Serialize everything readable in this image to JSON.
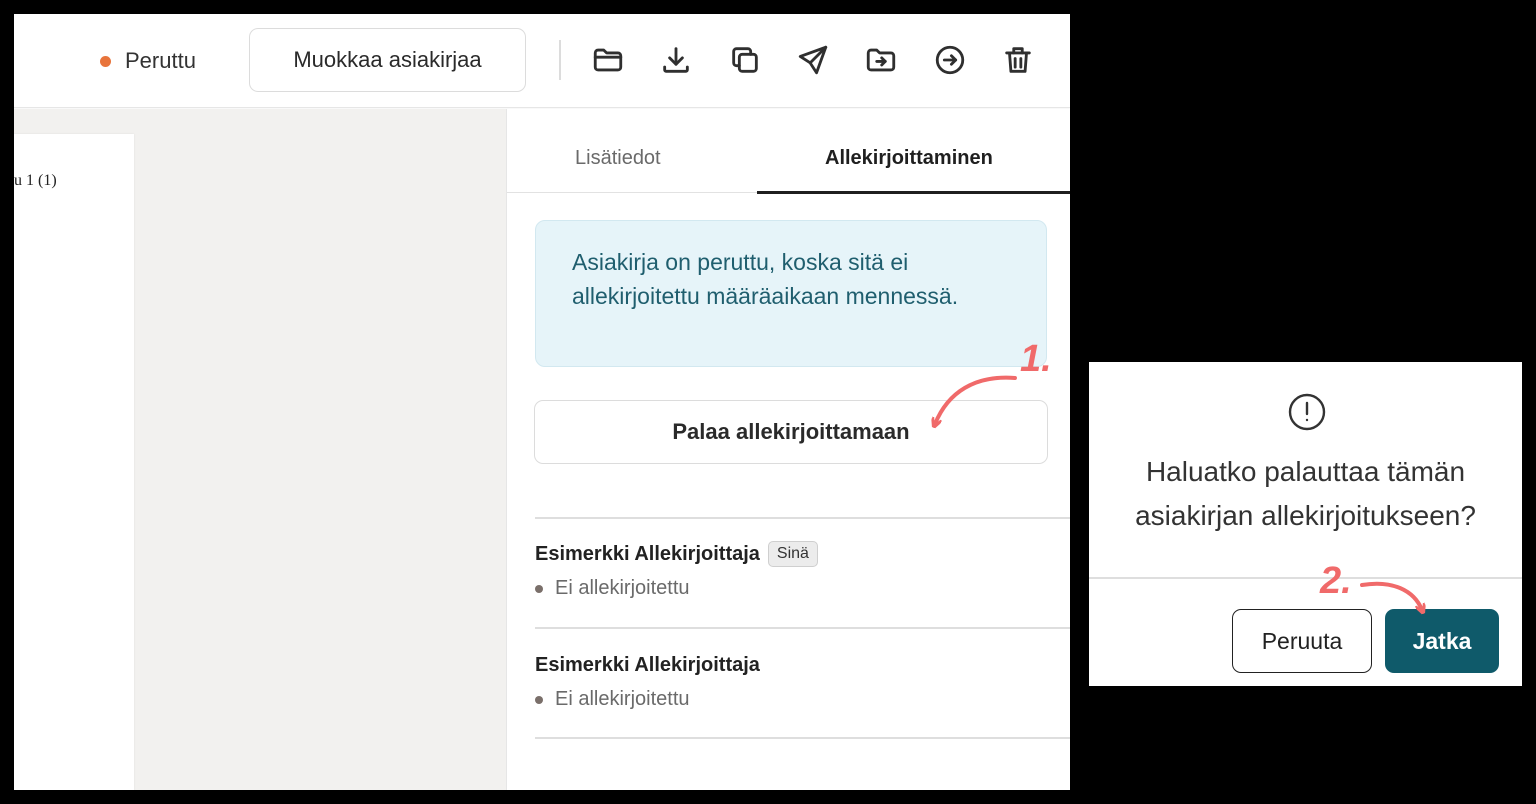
{
  "toolbar": {
    "status_label": "Peruttu",
    "status_color": "#e8743b",
    "edit_button_label": "Muokkaa asiakirjaa",
    "icons": [
      "folder-icon",
      "download-icon",
      "copy-icon",
      "send-icon",
      "move-to-folder-icon",
      "sign-in-icon",
      "trash-icon"
    ]
  },
  "document": {
    "page_text": "u  1 (1)"
  },
  "sidebar": {
    "tabs": [
      {
        "label": "Lisätiedot",
        "active": false
      },
      {
        "label": "Allekirjoittaminen",
        "active": true
      }
    ],
    "notice_text": "Asiakirja on peruttu, koska sitä ei allekirjoitettu määräaikaan mennessä.",
    "restore_button_label": "Palaa allekirjoittamaan",
    "signers": [
      {
        "name": "Esimerkki Allekirjoittaja",
        "badge": "Sinä",
        "status": "Ei allekirjoitettu"
      },
      {
        "name": "Esimerkki Allekirjoittaja",
        "badge": "",
        "status": "Ei allekirjoitettu"
      }
    ]
  },
  "dialog": {
    "question": "Haluatko palauttaa tämän asiakirjan allekirjoitukseen?",
    "cancel_label": "Peruuta",
    "continue_label": "Jatka",
    "continue_color": "#0f5a6a"
  },
  "annotations": {
    "step1": "1.",
    "step2": "2.",
    "color": "#f06a6a"
  }
}
